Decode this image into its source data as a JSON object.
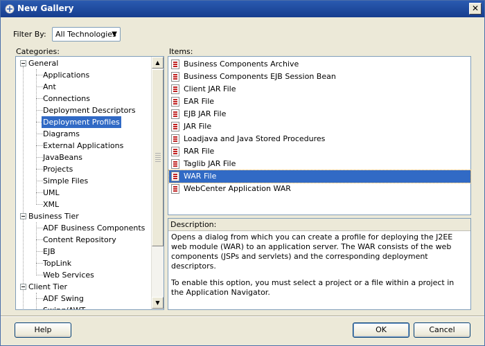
{
  "window": {
    "title": "New Gallery"
  },
  "filter": {
    "label": "Filter By:",
    "value": "All Technologies"
  },
  "categories": {
    "label": "Categories:",
    "general": {
      "label": "General",
      "children": [
        "Applications",
        "Ant",
        "Connections",
        "Deployment Descriptors",
        "Deployment Profiles",
        "Diagrams",
        "External Applications",
        "JavaBeans",
        "Projects",
        "Simple Files",
        "UML",
        "XML"
      ]
    },
    "business_tier": {
      "label": "Business Tier",
      "children": [
        "ADF Business Components",
        "Content Repository",
        "EJB",
        "TopLink",
        "Web Services"
      ]
    },
    "client_tier": {
      "label": "Client Tier",
      "children": [
        "ADF Swing",
        "Swing/AWT"
      ]
    },
    "selected": "Deployment Profiles"
  },
  "items": {
    "label": "Items:",
    "list": [
      "Business Components Archive",
      "Business Components EJB Session Bean",
      "Client JAR File",
      "EAR File",
      "EJB JAR File",
      "JAR File",
      "Loadjava and Java Stored Procedures",
      "RAR File",
      "Taglib JAR File",
      "WAR File",
      "WebCenter Application WAR"
    ],
    "selected": "WAR File"
  },
  "description": {
    "label": "Description:",
    "p1": "Opens a dialog from which you can create a profile for deploying the J2EE web module (WAR) to an application server. The WAR consists of the web components (JSPs and servlets) and the corresponding deployment descriptors.",
    "p2": "To enable this option, you must select a project or a file within a project in the Application Navigator."
  },
  "buttons": {
    "help": "Help",
    "ok": "OK",
    "cancel": "Cancel"
  },
  "icons": {
    "title": "gallery-icon",
    "item": "file-icon",
    "close": "close-icon"
  }
}
